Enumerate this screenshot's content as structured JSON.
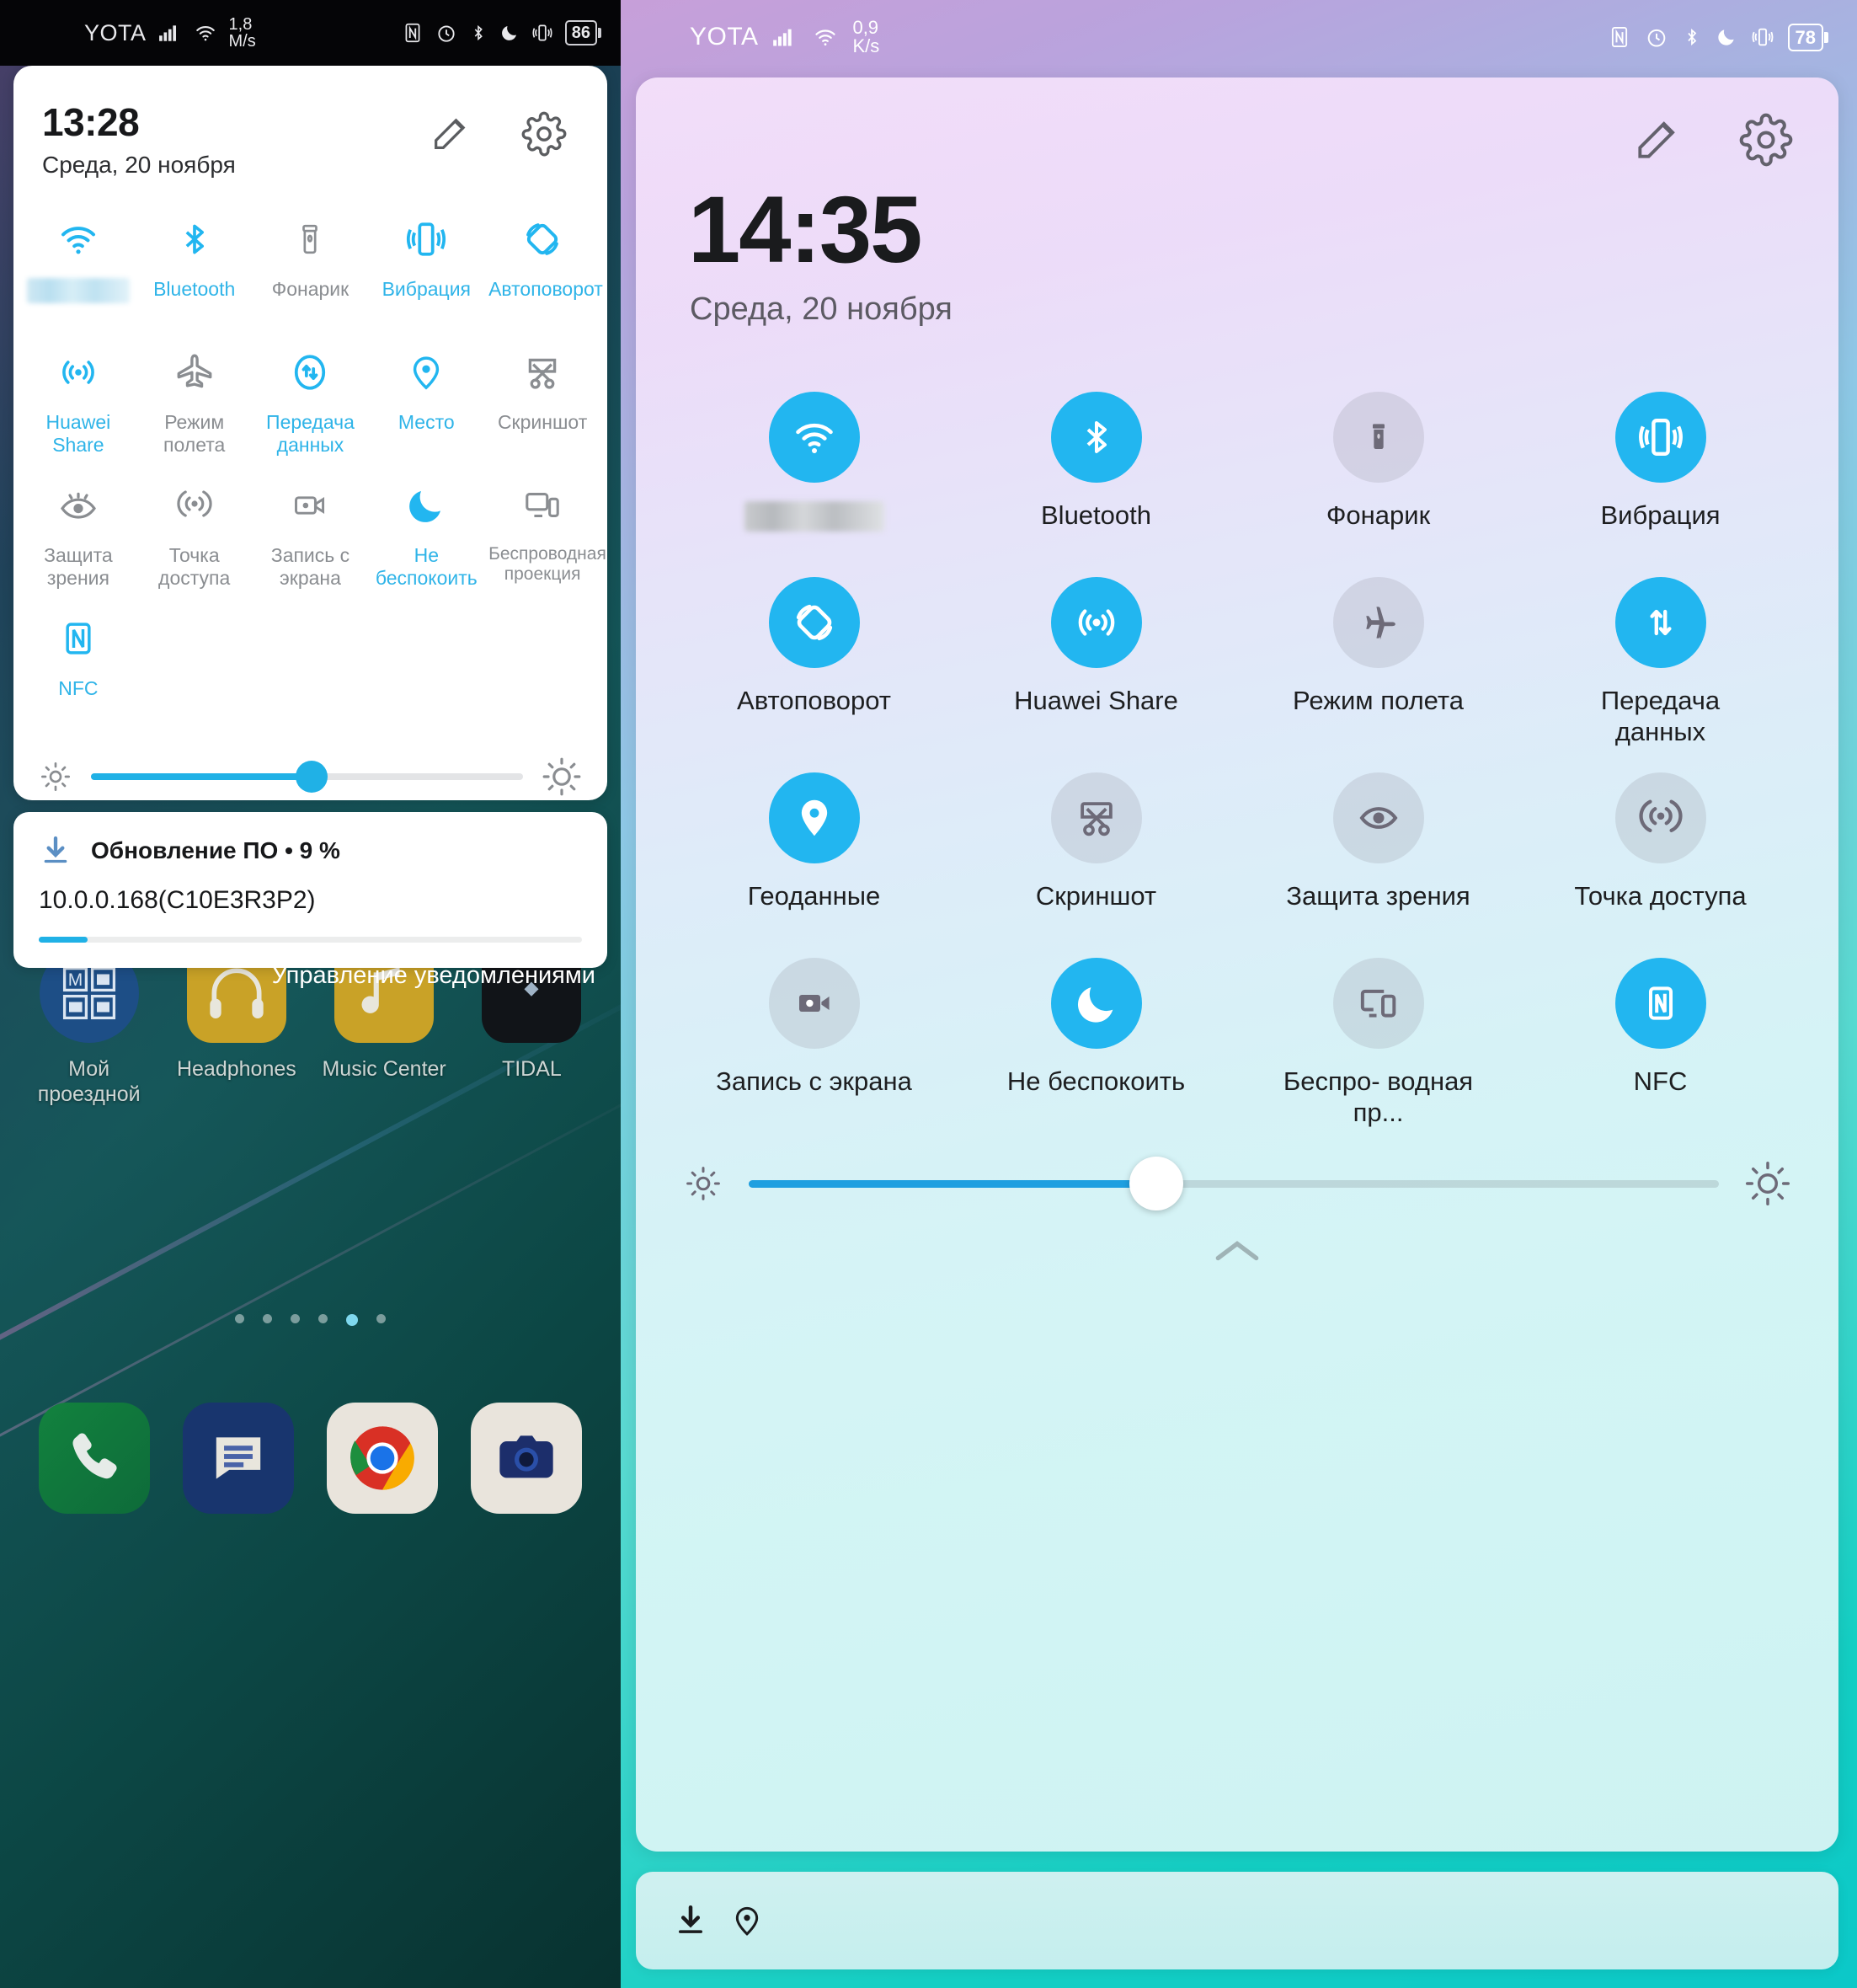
{
  "left": {
    "status_bar": {
      "carrier": "YOTA",
      "speed_value": "1,8",
      "speed_unit": "M/s",
      "battery": "86",
      "icons": [
        "nfc-icon",
        "alarm-icon",
        "bluetooth-icon",
        "do-not-disturb-icon",
        "vibrate-icon",
        "battery-icon"
      ]
    },
    "shade": {
      "clock": "13:28",
      "date": "Среда, 20 ноября",
      "edit_icon": "pencil-icon",
      "settings_icon": "gear-icon",
      "tiles": [
        {
          "label": "",
          "icon": "wifi-icon",
          "state": "on",
          "blurred": true
        },
        {
          "label": "Bluetooth",
          "icon": "bluetooth-icon",
          "state": "on"
        },
        {
          "label": "Фонарик",
          "icon": "flashlight-icon",
          "state": "off"
        },
        {
          "label": "Вибрация",
          "icon": "vibrate-icon",
          "state": "on"
        },
        {
          "label": "Автоповорот",
          "icon": "auto-rotate-icon",
          "state": "on"
        },
        {
          "label": "Huawei Share",
          "icon": "huawei-share-icon",
          "state": "on"
        },
        {
          "label": "Режим полета",
          "icon": "airplane-icon",
          "state": "off"
        },
        {
          "label": "Передача данных",
          "icon": "mobile-data-icon",
          "state": "on"
        },
        {
          "label": "Место",
          "icon": "location-pin-icon",
          "state": "on"
        },
        {
          "label": "Скриншот",
          "icon": "screenshot-scissors-icon",
          "state": "off"
        },
        {
          "label": "Защита зрения",
          "icon": "eye-comfort-icon",
          "state": "off"
        },
        {
          "label": "Точка доступа",
          "icon": "hotspot-icon",
          "state": "off"
        },
        {
          "label": "Запись с экрана",
          "icon": "screen-record-icon",
          "state": "off"
        },
        {
          "label": "Не беспокоить",
          "icon": "moon-icon",
          "state": "on"
        },
        {
          "label": "Беспроводная проекция",
          "icon": "wireless-projection-icon",
          "state": "off"
        },
        {
          "label": "NFC",
          "icon": "nfc-icon",
          "state": "on"
        }
      ],
      "brightness": {
        "low_icon": "brightness-low-icon",
        "high_icon": "brightness-high-icon",
        "value_percent": 51
      },
      "collapse_icon": "chevron-up-icon"
    },
    "notification": {
      "icon": "download-icon",
      "title": "Обновление ПО • 9 %",
      "subtitle": "10.0.0.168(C10E3R3P2)",
      "progress_percent": 9
    },
    "manage_notifications": "Управление уведомлениями",
    "home_apps": [
      {
        "name": "Мой проездной",
        "icon": "transit-card-icon"
      },
      {
        "name": "Headphones",
        "icon": "headphones-icon"
      },
      {
        "name": "Music Center",
        "icon": "music-note-icon"
      },
      {
        "name": "TIDAL",
        "icon": "tidal-icon"
      }
    ],
    "page_dots": {
      "count": 6,
      "active_index": 4
    },
    "dock": [
      {
        "name": "phone-app-icon"
      },
      {
        "name": "messages-app-icon"
      },
      {
        "name": "chrome-app-icon"
      },
      {
        "name": "camera-app-icon"
      }
    ]
  },
  "right": {
    "status_bar": {
      "carrier": "YOTA",
      "speed_value": "0,9",
      "speed_unit": "K/s",
      "battery": "78",
      "icons": [
        "nfc-icon",
        "alarm-icon",
        "bluetooth-icon",
        "do-not-disturb-icon",
        "vibrate-icon",
        "battery-icon"
      ]
    },
    "shade": {
      "clock": "14:35",
      "date": "Среда, 20 ноября",
      "edit_icon": "pencil-icon",
      "settings_icon": "gear-icon",
      "tiles": [
        {
          "label": "",
          "icon": "wifi-icon",
          "state": "on",
          "blurred": true
        },
        {
          "label": "Bluetooth",
          "icon": "bluetooth-icon",
          "state": "on"
        },
        {
          "label": "Фонарик",
          "icon": "flashlight-icon",
          "state": "off"
        },
        {
          "label": "Вибрация",
          "icon": "vibrate-icon",
          "state": "on"
        },
        {
          "label": "Автоповорот",
          "icon": "auto-rotate-icon",
          "state": "on"
        },
        {
          "label": "Huawei Share",
          "icon": "huawei-share-icon",
          "state": "on"
        },
        {
          "label": "Режим полета",
          "icon": "airplane-icon",
          "state": "off"
        },
        {
          "label": "Передача данных",
          "icon": "mobile-data-icon",
          "state": "on"
        },
        {
          "label": "Геоданные",
          "icon": "location-pin-icon",
          "state": "on"
        },
        {
          "label": "Скриншот",
          "icon": "screenshot-scissors-icon",
          "state": "off"
        },
        {
          "label": "Защита зрения",
          "icon": "eye-comfort-icon",
          "state": "off"
        },
        {
          "label": "Точка доступа",
          "icon": "hotspot-icon",
          "state": "off"
        },
        {
          "label": "Запись с экрана",
          "icon": "screen-record-icon",
          "state": "off"
        },
        {
          "label": "Не беспокоить",
          "icon": "moon-icon",
          "state": "on"
        },
        {
          "label": "Беспро- водная пр...",
          "icon": "wireless-projection-icon",
          "state": "off"
        },
        {
          "label": "NFC",
          "icon": "nfc-icon",
          "state": "on"
        }
      ],
      "brightness": {
        "low_icon": "brightness-low-icon",
        "high_icon": "brightness-high-icon",
        "value_percent": 42
      },
      "collapse_icon": "chevron-up-icon"
    },
    "notification_bar": {
      "icons": [
        "download-icon",
        "location-pin-icon"
      ]
    }
  },
  "colors": {
    "accent_blue": "#22b6f0",
    "tile_off_grey": "#8a8d91",
    "left_panel_bg": "#ffffff"
  }
}
